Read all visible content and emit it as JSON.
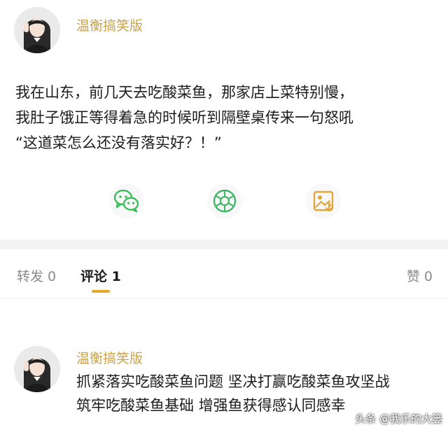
{
  "post": {
    "author": "温衡搞笑版",
    "lines": [
      "我在山东，前几天去吃酸菜鱼，那家店上菜特别慢，",
      "我肚子饿正等得着急的时候听到隔壁桌传来一句怒吼",
      "“这道菜怎么还没有落实好？！”"
    ]
  },
  "share": {
    "wechat_color": "#3dbe5c",
    "moments_color": "#42b868",
    "image_color": "#e0a73a"
  },
  "tabs": {
    "repost_label": "转发 0",
    "comments_label": "评论 1",
    "likes_label": "赞 0",
    "accent": "#e8a629"
  },
  "comment": {
    "author": "温衡搞笑版",
    "lines": [
      "抓紧落实吃酸菜鱼问题 坚决打赢吃酸菜鱼攻坚战",
      "筑牢吃酸菜鱼基础 增强鱼获得感认同感幸"
    ]
  },
  "watermark": "头条 @我乐的大篓"
}
